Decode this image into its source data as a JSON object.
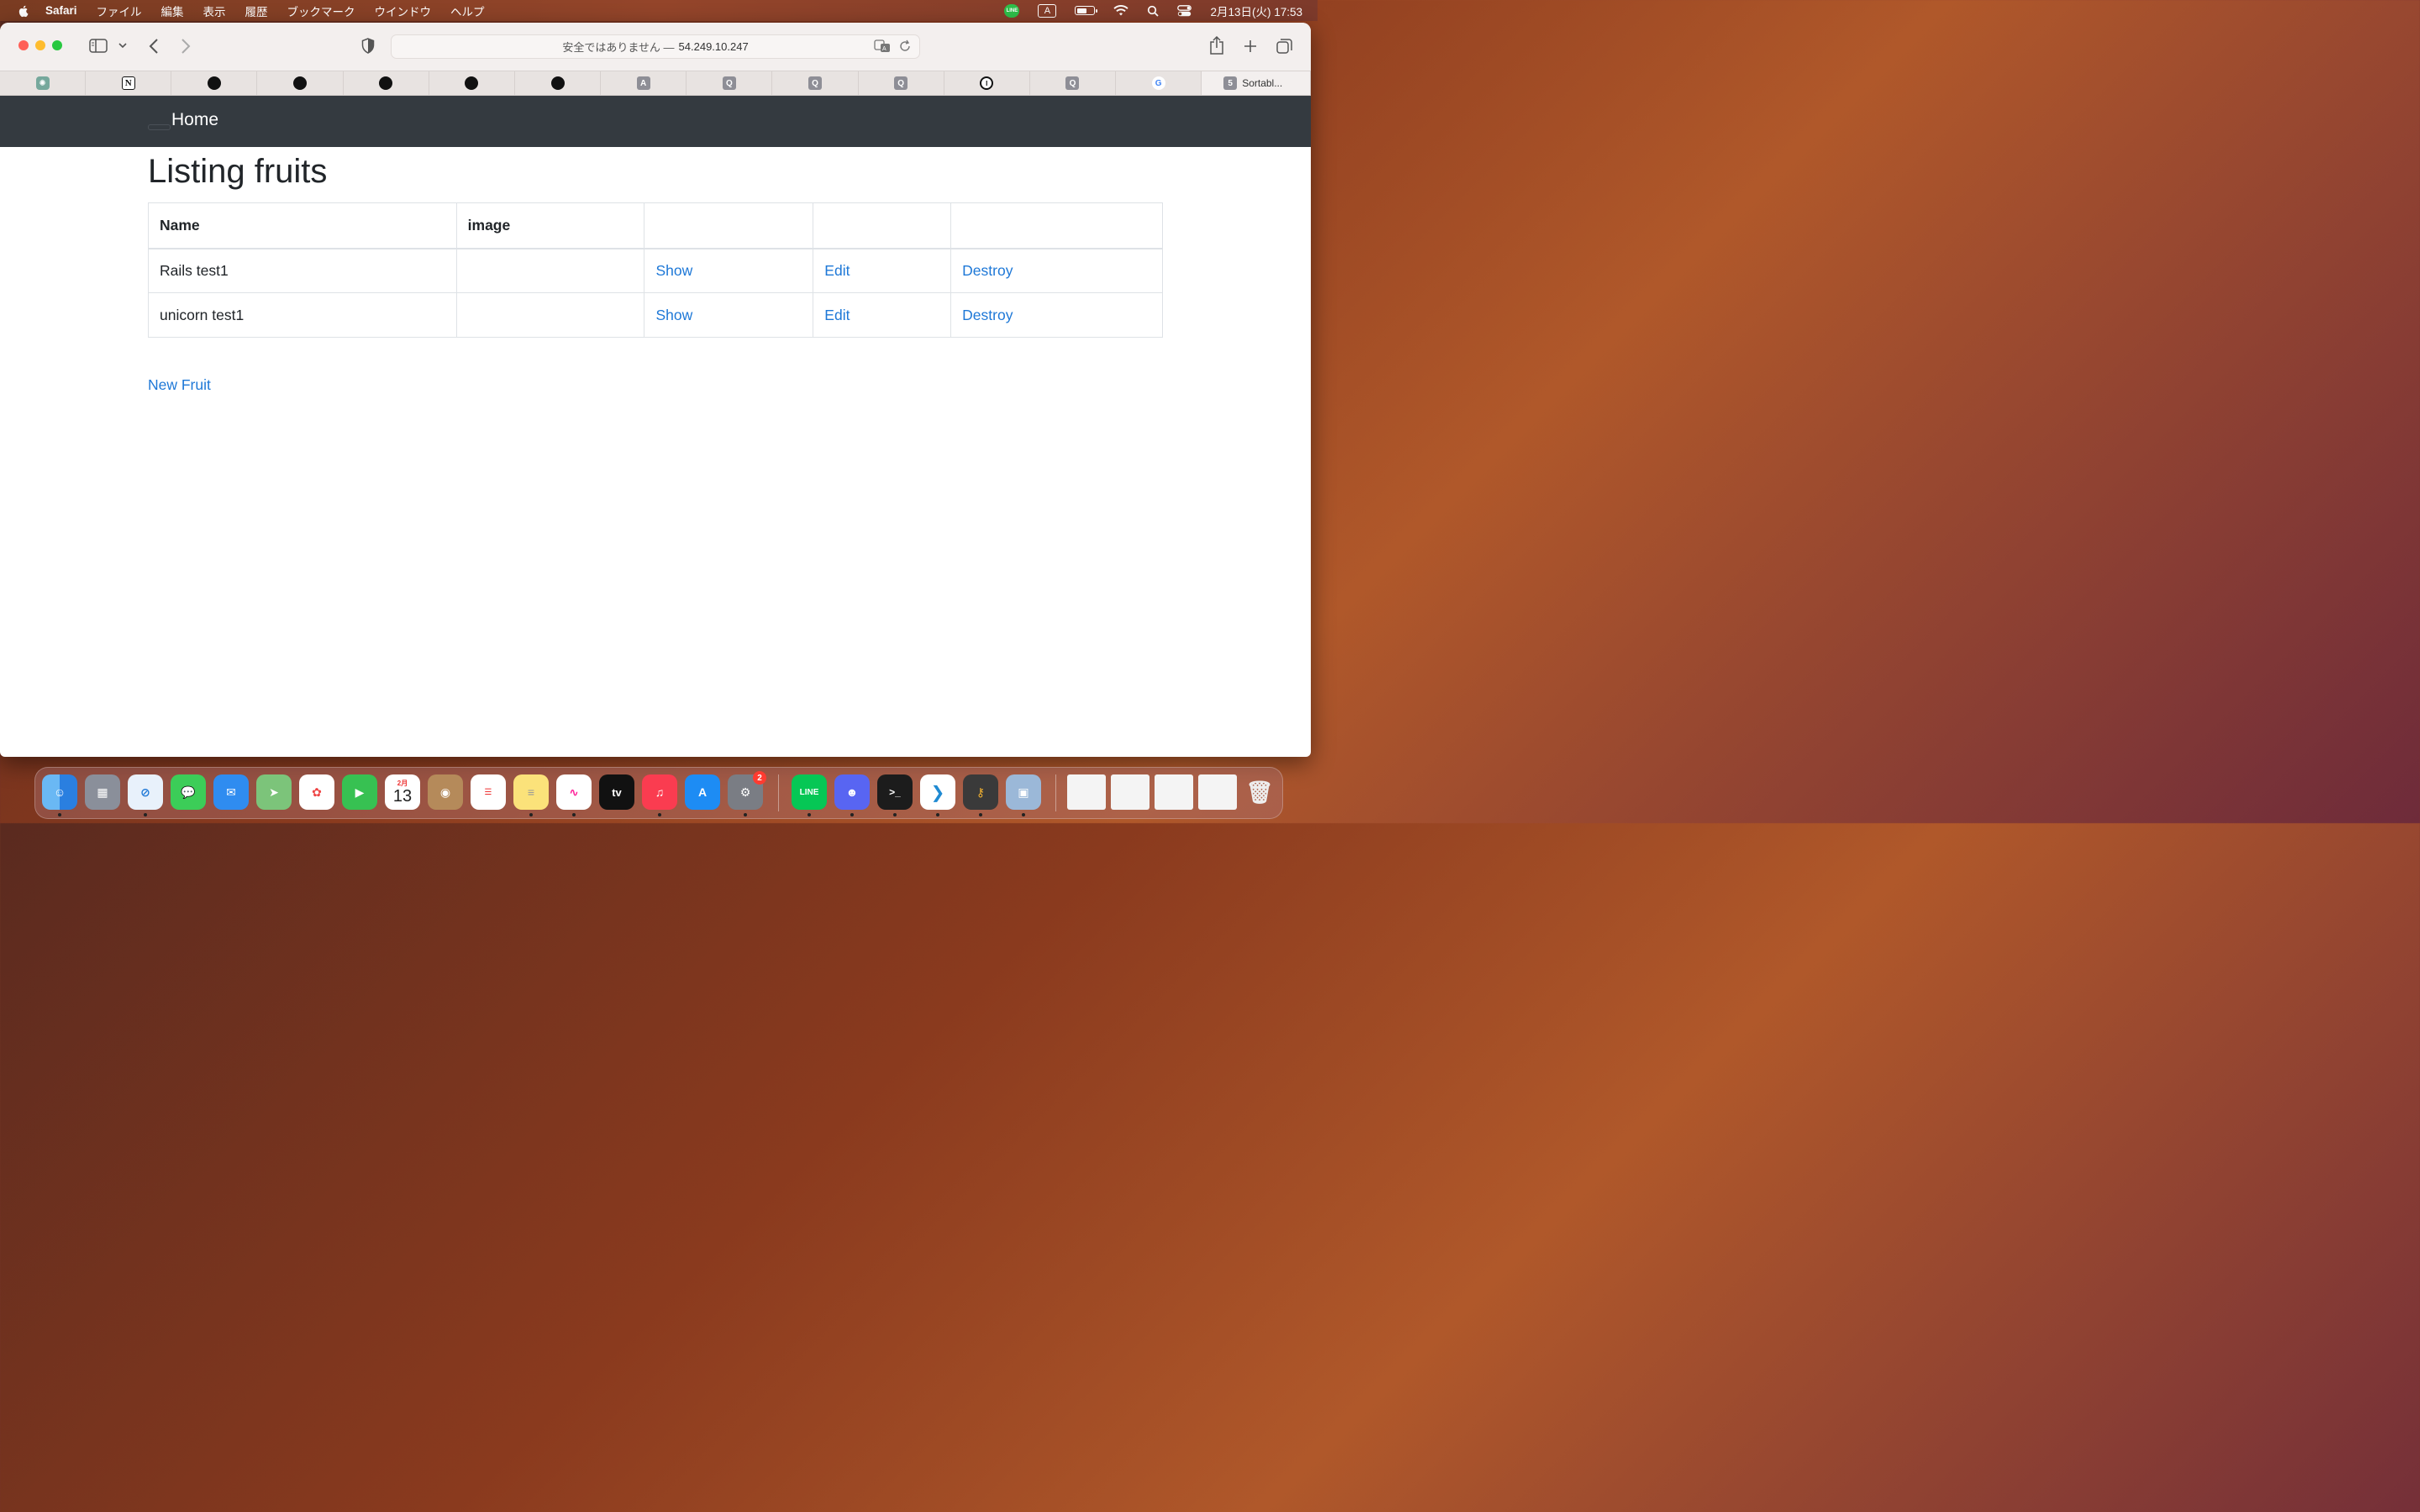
{
  "menubar": {
    "app_name": "Safari",
    "items": [
      "ファイル",
      "編集",
      "表示",
      "履歴",
      "ブックマーク",
      "ウインドウ",
      "ヘルプ"
    ],
    "status_line_label": "LINE",
    "input_mode": "A",
    "clock": "2月13日(火)  17:53"
  },
  "browser": {
    "address_prefix": "安全ではありません —",
    "address_host": "54.249.10.247",
    "favorites": [
      {
        "icon": "chatgpt-icon",
        "label": ""
      },
      {
        "icon": "notion-icon",
        "label": "N"
      },
      {
        "icon": "github-icon",
        "label": ""
      },
      {
        "icon": "github-icon",
        "label": ""
      },
      {
        "icon": "github-icon",
        "label": ""
      },
      {
        "icon": "github-icon",
        "label": ""
      },
      {
        "icon": "github-icon",
        "label": ""
      },
      {
        "icon": "a-icon",
        "label": "A"
      },
      {
        "icon": "qiita-icon",
        "label": "Q"
      },
      {
        "icon": "qiita-icon",
        "label": "Q"
      },
      {
        "icon": "qiita-icon",
        "label": "Q"
      },
      {
        "icon": "onepassword-icon",
        "label": "I"
      },
      {
        "icon": "qiita-icon",
        "label": "Q"
      },
      {
        "icon": "google-icon",
        "label": "G"
      }
    ],
    "active_tab": {
      "icon_label": "5",
      "title": "Sortabl..."
    }
  },
  "page": {
    "nav_brand": "Home",
    "title": "Listing fruits",
    "table": {
      "headers": [
        "Name",
        "image",
        "",
        "",
        ""
      ],
      "rows": [
        {
          "name": "Rails test1",
          "image": "",
          "show": "Show",
          "edit": "Edit",
          "destroy": "Destroy"
        },
        {
          "name": "unicorn test1",
          "image": "",
          "show": "Show",
          "edit": "Edit",
          "destroy": "Destroy"
        }
      ]
    },
    "new_link": "New Fruit"
  },
  "dock": {
    "calendar_month": "2月",
    "calendar_day": "13",
    "settings_badge": "2",
    "line_label": "LINE",
    "appletv_label": "tv"
  },
  "colors": {
    "navbar_bg": "#343a40",
    "link": "#1e78d7",
    "text": "#212529"
  }
}
